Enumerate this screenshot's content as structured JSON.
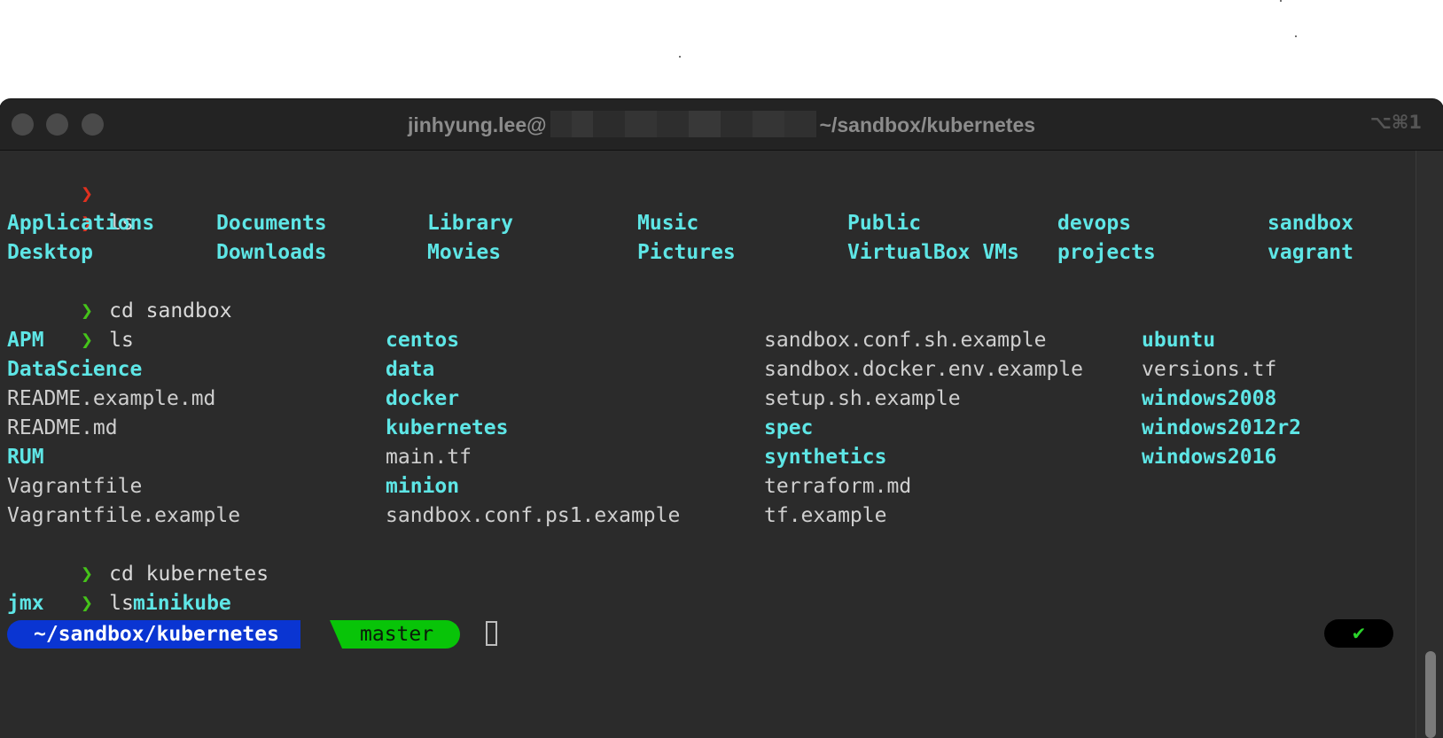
{
  "window": {
    "title_user": "jinhyung.lee@",
    "title_path": "~/sandbox/kubernetes",
    "shortcut": "⌥⌘1"
  },
  "icons": {
    "prompt_chevron": "❯",
    "check": "✔"
  },
  "colors": {
    "directory": "#5ee6e6",
    "prompt_error": "#e0301e",
    "prompt_ok": "#45c31a",
    "powerline_path_bg": "#0a35d2",
    "powerline_branch_bg": "#08c408"
  },
  "terminal": {
    "commands": {
      "ls1": "ls",
      "cd_sandbox": "cd sandbox",
      "ls2": "ls",
      "cd_kubernetes": "cd kubernetes",
      "ls3": "ls"
    },
    "home_listing": {
      "row1": [
        "Applications",
        "Documents",
        "Library",
        "Music",
        "Public",
        "devops",
        "sandbox"
      ],
      "row2": [
        "Desktop",
        "Downloads",
        "Movies",
        "Pictures",
        "VirtualBox VMs",
        "projects",
        "vagrant"
      ]
    },
    "sandbox_listing": {
      "col1": [
        "APM",
        "DataScience",
        "README.example.md",
        "README.md",
        "RUM",
        "Vagrantfile",
        "Vagrantfile.example"
      ],
      "col2": [
        "centos",
        "data",
        "docker",
        "kubernetes",
        "main.tf",
        "minion",
        "sandbox.conf.ps1.example"
      ],
      "col3": [
        "sandbox.conf.sh.example",
        "sandbox.docker.env.example",
        "setup.sh.example",
        "spec",
        "synthetics",
        "terraform.md",
        "tf.example"
      ],
      "col4": [
        "ubuntu",
        "versions.tf",
        "windows2008",
        "windows2012r2",
        "windows2016"
      ]
    },
    "kubernetes_listing": [
      "jmx",
      "minikube"
    ],
    "prompt": {
      "path": "~/sandbox/kubernetes",
      "branch": "master"
    }
  }
}
